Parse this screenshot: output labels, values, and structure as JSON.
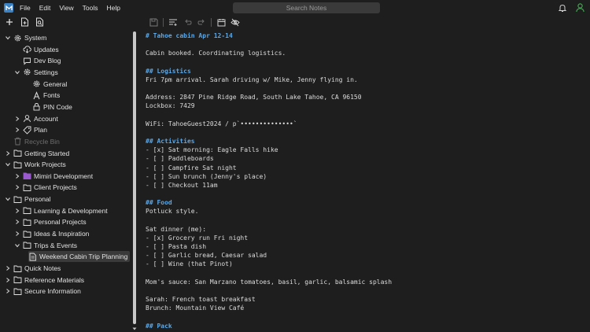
{
  "menu": {
    "items": [
      "File",
      "Edit",
      "View",
      "Tools",
      "Help"
    ]
  },
  "search": {
    "placeholder": "Search Notes"
  },
  "colors": {
    "accent": "#5aa7e6",
    "folder_purple": "#9b59d0",
    "avatar_green": "#3aa84a"
  },
  "sidebar": {
    "items": [
      {
        "label": "System",
        "level": 0,
        "expand": "open",
        "icon": "gear-icon"
      },
      {
        "label": "Updates",
        "level": 1,
        "expand": "none",
        "icon": "cloud-download-icon"
      },
      {
        "label": "Dev Blog",
        "level": 1,
        "expand": "none",
        "icon": "chat-icon"
      },
      {
        "label": "Settings",
        "level": 1,
        "expand": "open",
        "icon": "gear-icon"
      },
      {
        "label": "General",
        "level": 2,
        "expand": "none",
        "icon": "gear-icon"
      },
      {
        "label": "Fonts",
        "level": 2,
        "expand": "none",
        "icon": "font-icon"
      },
      {
        "label": "PIN Code",
        "level": 2,
        "expand": "none",
        "icon": "lock-icon"
      },
      {
        "label": "Account",
        "level": 1,
        "expand": "closed",
        "icon": "user-icon"
      },
      {
        "label": "Plan",
        "level": 1,
        "expand": "closed",
        "icon": "tag-icon"
      },
      {
        "label": "Recycle Bin",
        "level": 0,
        "expand": "none",
        "icon": "trash-icon",
        "dim": true
      },
      {
        "label": "Getting Started",
        "level": 0,
        "expand": "closed",
        "icon": "folder-icon"
      },
      {
        "label": "Work Projects",
        "level": 0,
        "expand": "open",
        "icon": "folder-icon"
      },
      {
        "label": "Mimiri Development",
        "level": 1,
        "expand": "closed",
        "icon": "folder-purple-icon"
      },
      {
        "label": "Client Projects",
        "level": 1,
        "expand": "closed",
        "icon": "folder-icon"
      },
      {
        "label": "Personal",
        "level": 0,
        "expand": "open",
        "icon": "folder-icon"
      },
      {
        "label": "Learning & Development",
        "level": 1,
        "expand": "closed",
        "icon": "folder-icon"
      },
      {
        "label": "Personal Projects",
        "level": 1,
        "expand": "closed",
        "icon": "folder-icon"
      },
      {
        "label": "Ideas & Inspiration",
        "level": 1,
        "expand": "closed",
        "icon": "folder-icon"
      },
      {
        "label": "Trips & Events",
        "level": 1,
        "expand": "open",
        "icon": "folder-icon"
      },
      {
        "label": "Weekend Cabin Trip Planning",
        "level": 2,
        "expand": "none",
        "icon": "note-icon",
        "selected": true
      },
      {
        "label": "Quick Notes",
        "level": 0,
        "expand": "closed",
        "icon": "folder-icon"
      },
      {
        "label": "Reference Materials",
        "level": 0,
        "expand": "closed",
        "icon": "folder-icon"
      },
      {
        "label": "Secure Information",
        "level": 0,
        "expand": "closed",
        "icon": "folder-icon"
      }
    ]
  },
  "note": {
    "lines": [
      {
        "text": "# Tahoe cabin Apr 12-14",
        "heading": true
      },
      {
        "text": ""
      },
      {
        "text": "Cabin booked. Coordinating logistics."
      },
      {
        "text": ""
      },
      {
        "text": "## Logistics",
        "heading": true
      },
      {
        "text": "Fri 7pm arrival. Sarah driving w/ Mike, Jenny flying in."
      },
      {
        "text": ""
      },
      {
        "text": "Address: 2847 Pine Ridge Road, South Lake Tahoe, CA 96150"
      },
      {
        "text": "Lockbox: 7429"
      },
      {
        "text": ""
      },
      {
        "text": "WiFi: TahoeGuest2024 / p`••••••••••••••`"
      },
      {
        "text": ""
      },
      {
        "text": "## Activities",
        "heading": true
      },
      {
        "text": "- [x] Sat morning: Eagle Falls hike"
      },
      {
        "text": "- [ ] Paddleboards"
      },
      {
        "text": "- [ ] Campfire Sat night"
      },
      {
        "text": "- [ ] Sun brunch (Jenny's place)"
      },
      {
        "text": "- [ ] Checkout 11am"
      },
      {
        "text": ""
      },
      {
        "text": "## Food",
        "heading": true
      },
      {
        "text": "Potluck style."
      },
      {
        "text": ""
      },
      {
        "text": "Sat dinner (me):"
      },
      {
        "text": "- [x] Grocery run Fri night"
      },
      {
        "text": "- [ ] Pasta dish"
      },
      {
        "text": "- [ ] Garlic bread, Caesar salad"
      },
      {
        "text": "- [ ] Wine (that Pinot)"
      },
      {
        "text": ""
      },
      {
        "text": "Mom's sauce: San Marzano tomatoes, basil, garlic, balsamic splash"
      },
      {
        "text": ""
      },
      {
        "text": "Sarah: French toast breakfast"
      },
      {
        "text": "Brunch: Mountain View Café"
      },
      {
        "text": ""
      },
      {
        "text": "## Pack",
        "heading": true
      }
    ]
  }
}
